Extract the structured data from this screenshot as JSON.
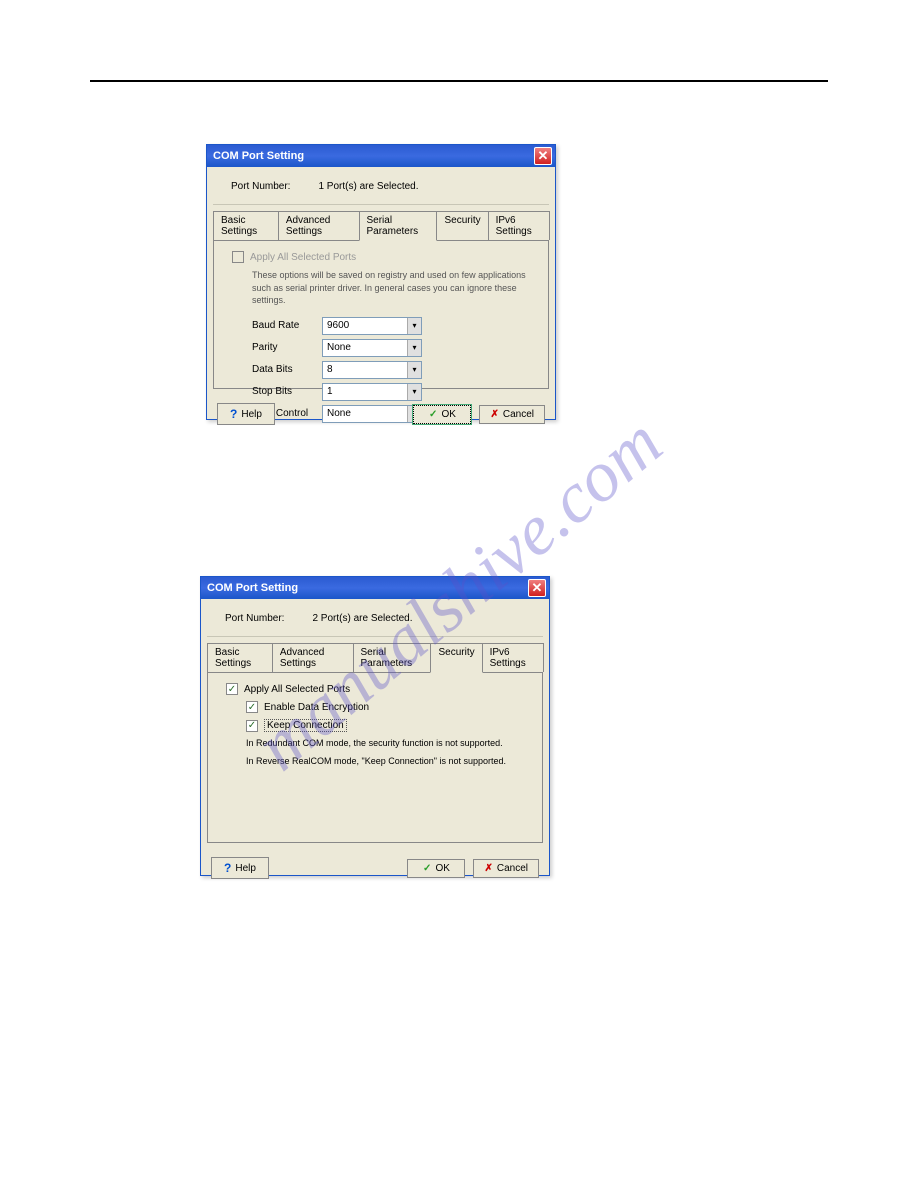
{
  "watermark": "manualshive.com",
  "dialog1": {
    "title": "COM Port Setting",
    "portNumberLabel": "Port Number:",
    "portNumberValue": "1 Port(s) are Selected.",
    "tabs": [
      "Basic Settings",
      "Advanced Settings",
      "Serial Parameters",
      "Security",
      "IPv6 Settings"
    ],
    "activeTab": "Serial Parameters",
    "applyAllLabel": "Apply All Selected Ports",
    "infoText": "These options will be saved on registry and used on few applications such as serial printer driver. In general cases you can ignore these settings.",
    "fields": {
      "baudRateLabel": "Baud Rate",
      "baudRateValue": "9600",
      "parityLabel": "Parity",
      "parityValue": "None",
      "dataBitsLabel": "Data Bits",
      "dataBitsValue": "8",
      "stopBitsLabel": "Stop Bits",
      "stopBitsValue": "1",
      "flowControlLabel": "Flow Control",
      "flowControlValue": "None"
    },
    "buttons": {
      "help": "Help",
      "ok": "OK",
      "cancel": "Cancel"
    }
  },
  "dialog2": {
    "title": "COM Port Setting",
    "portNumberLabel": "Port Number:",
    "portNumberValue": "2 Port(s) are Selected.",
    "tabs": [
      "Basic Settings",
      "Advanced Settings",
      "Serial Parameters",
      "Security",
      "IPv6 Settings"
    ],
    "activeTab": "Security",
    "applyAllLabel": "Apply All Selected Ports",
    "enableEncLabel": "Enable Data Encryption",
    "keepConnLabel": "Keep Connection",
    "note1": "In Redundant COM mode,  the security function is not supported.",
    "note2": "In Reverse RealCOM mode, \"Keep Connection\" is not supported.",
    "buttons": {
      "help": "Help",
      "ok": "OK",
      "cancel": "Cancel"
    }
  }
}
